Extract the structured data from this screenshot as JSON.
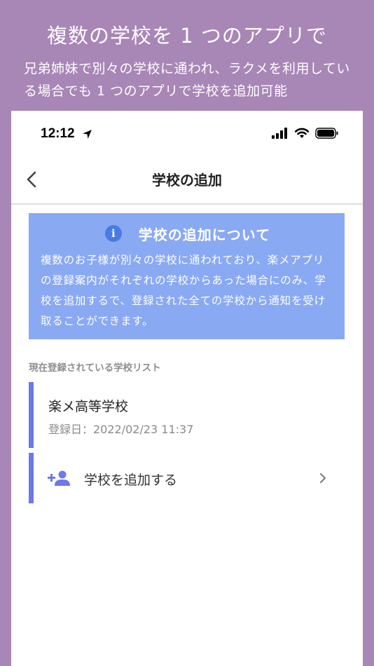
{
  "promo": {
    "title": "複数の学校を 1 つのアプリで",
    "subtitle": "兄弟姉妹で別々の学校に通われ、ラクメを利用している場合でも 1 つのアプリで学校を追加可能"
  },
  "status_bar": {
    "time": "12:12"
  },
  "nav": {
    "title": "学校の追加"
  },
  "info": {
    "icon_glyph": "i",
    "title": "学校の追加について",
    "body": "複数のお子様が別々の学校に通われており、楽メアプリの登録案内がそれぞれの学校からあった場合にのみ、学校を追加するで、登録された全ての学校から通知を受け取ることができます。"
  },
  "school_list": {
    "caption": "現在登録されている学校リスト",
    "items": [
      {
        "name": "楽メ高等学校",
        "registered": "登録日：2022/02/23 11:37"
      }
    ]
  },
  "add_school": {
    "label": "学校を追加する"
  },
  "colors": {
    "background": "#a886b6",
    "info_panel": "#8aa9f3",
    "accent": "#6b79e9"
  },
  "icons": [
    "location-arrow-icon",
    "signal-icon",
    "wifi-icon",
    "battery-icon",
    "back-chevron-icon",
    "info-icon",
    "add-user-icon",
    "chevron-right-icon"
  ]
}
